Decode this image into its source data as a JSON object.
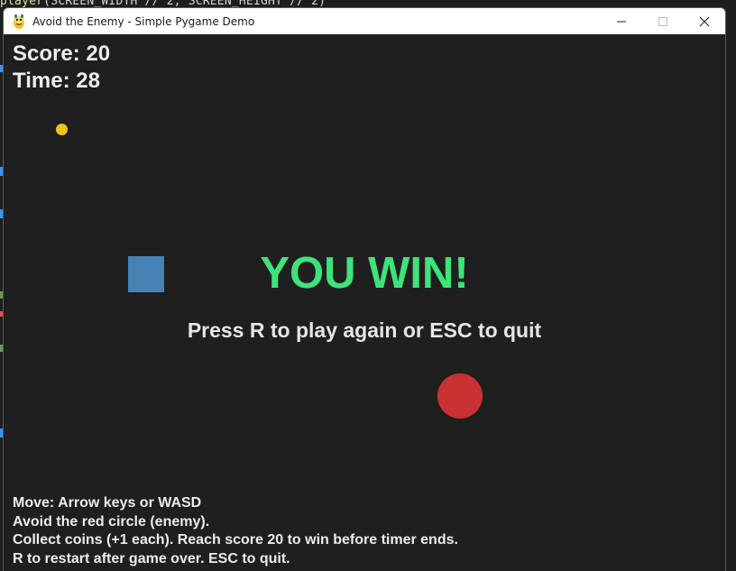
{
  "window": {
    "title": "Avoid the Enemy - Simple Pygame Demo"
  },
  "background_code": {
    "fn": "player",
    "args": "(SCREEN_WIDTH // 2, SCREEN_HEIGHT // 2)"
  },
  "hud": {
    "score": "Score: 20",
    "time": "Time: 28"
  },
  "overlay": {
    "headline": "YOU WIN!",
    "prompt": "Press R to play again or ESC to quit"
  },
  "instructions": [
    "Move: Arrow keys or WASD",
    "Avoid the red circle (enemy).",
    "Collect coins (+1 each). Reach score 20 to win before timer ends.",
    "R to restart after game over. ESC to quit."
  ],
  "colors": {
    "background": "#1f1f1f",
    "coin": "#f2c316",
    "player": "#4682b4",
    "enemy": "#c83232",
    "win_text": "#3ee37a"
  },
  "icons": {
    "app": "pygame-snake-icon",
    "minimize": "minimize-icon",
    "maximize": "maximize-icon",
    "close": "close-icon"
  }
}
